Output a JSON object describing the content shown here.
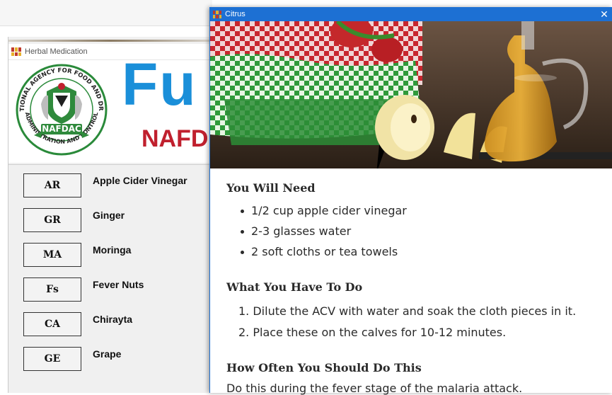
{
  "background_window": {
    "title": "Herbal Medication",
    "banner": {
      "seal_text_top": "NATIONAL AGENCY FOR FOOD AND DRUG",
      "seal_text_bottom": "ADMINISTRATION AND CONTROL",
      "seal_center": "NAFDAC",
      "headline": "Fu",
      "subline": "NAFD"
    },
    "herbs": [
      {
        "code": "AR",
        "name": "Apple Cider Vinegar"
      },
      {
        "code": "GR",
        "name": "Ginger"
      },
      {
        "code": "MA",
        "name": "Moringa"
      },
      {
        "code": "Fs",
        "name": "Fever Nuts"
      },
      {
        "code": "CA",
        "name": "Chirayta"
      },
      {
        "code": "GE",
        "name": "Grape"
      }
    ]
  },
  "citrus_window": {
    "title": "Citrus",
    "close_label": "✕",
    "you_will_need": {
      "heading": "You Will Need",
      "items": [
        "1/2 cup apple cider vinegar",
        "2-3 glasses water",
        "2 soft cloths or tea towels"
      ]
    },
    "what_to_do": {
      "heading": "What You Have To Do",
      "steps": [
        "1. Dilute the ACV with water and soak the cloth pieces in it.",
        "2. Place these on the calves for 10-12 minutes."
      ]
    },
    "how_often": {
      "heading": "How Often You Should Do This",
      "text": "Do this during the fever stage of the malaria attack."
    }
  }
}
